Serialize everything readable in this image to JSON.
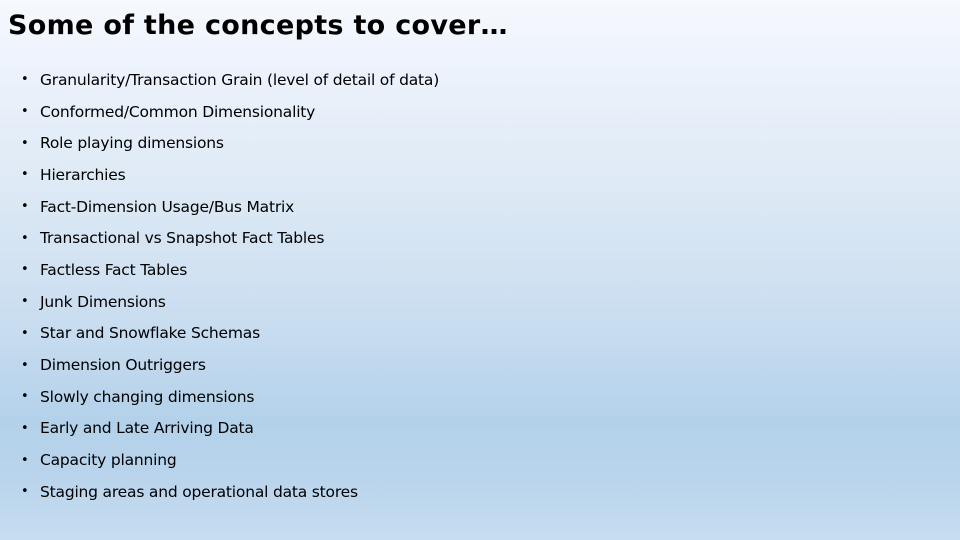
{
  "slide": {
    "title": "Some of the concepts to cover…",
    "bullet_glyph": "•",
    "items": [
      {
        "label": "Granularity/Transaction Grain  (level of detail of data)"
      },
      {
        "label": "Conformed/Common Dimensionality"
      },
      {
        "label": "Role playing dimensions"
      },
      {
        "label": "Hierarchies"
      },
      {
        "label": "Fact-Dimension Usage/Bus Matrix"
      },
      {
        "label": "Transactional vs Snapshot Fact Tables"
      },
      {
        "label": "Factless Fact Tables"
      },
      {
        "label": "Junk Dimensions"
      },
      {
        "label": "Star and Snowflake Schemas"
      },
      {
        "label": "Dimension Outriggers"
      },
      {
        "label": "Slowly changing dimensions"
      },
      {
        "label": "Early and Late Arriving Data"
      },
      {
        "label": "Capacity planning"
      },
      {
        "label": "Staging areas and operational data stores"
      }
    ]
  },
  "colors": {
    "background_top": "#f6f9fe",
    "background_mid": "#b3d1ea",
    "background_bottom": "#c7ddf0",
    "text": "#000000"
  }
}
